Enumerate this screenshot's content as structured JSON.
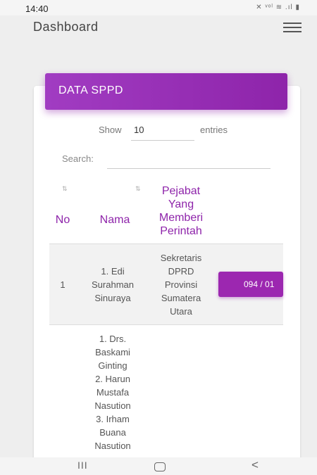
{
  "status_bar": {
    "time": "14:40",
    "icons": "✕ ᵛᵒˡ ≋ .ıl ▮"
  },
  "header": {
    "title": "Dashboard"
  },
  "card": {
    "title": "DATA SPPD"
  },
  "table_controls": {
    "show_label": "Show",
    "page_length": "10",
    "entries_label": "entries",
    "search_label": "Search:",
    "search_value": ""
  },
  "table": {
    "sort_glyph": "⇅",
    "columns": {
      "no": "No",
      "nama": "Nama",
      "pejabat": [
        "Pejabat",
        "Yang",
        "Memberi",
        "Perintah"
      ]
    },
    "rows": [
      {
        "no": "1",
        "nama": [
          "1. Edi",
          "Surahman",
          "Sinuraya"
        ],
        "pejabat": [
          "Sekretaris",
          "DPRD",
          "Provinsi",
          "Sumatera",
          "Utara"
        ],
        "nomor": "094 / 01"
      },
      {
        "nama": [
          "1. Drs.",
          "Baskami",
          "Ginting",
          "2. Harun",
          "Mustafa",
          "Nasution",
          "3. Irham",
          "Buana",
          "Nasution"
        ]
      }
    ]
  },
  "nav_bar": {
    "recent": "III",
    "back": "<"
  },
  "colors": {
    "accent": "#9c27b0",
    "header_text": "#8e24aa"
  }
}
